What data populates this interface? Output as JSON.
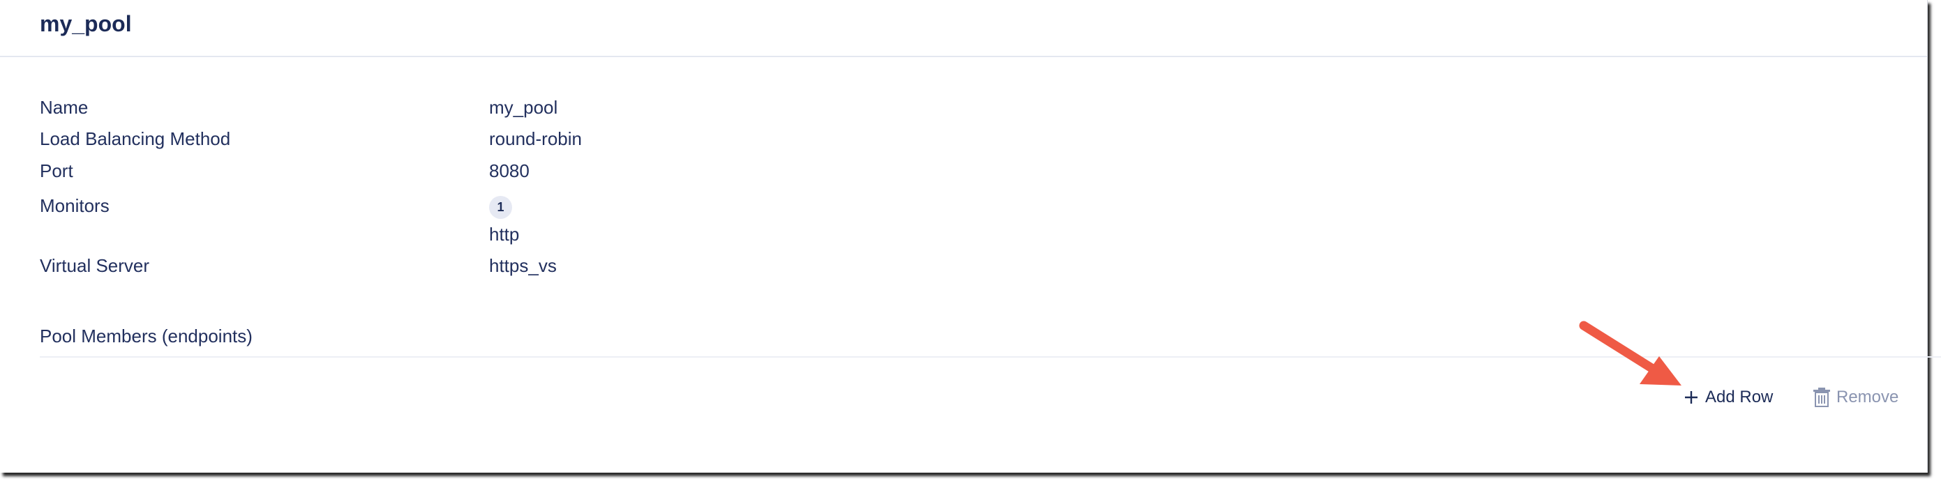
{
  "panel": {
    "title": "my_pool"
  },
  "properties": {
    "name": {
      "label": "Name",
      "value": "my_pool"
    },
    "load_balancing": {
      "label": "Load Balancing Method",
      "value": "round-robin"
    },
    "port": {
      "label": "Port",
      "value": "8080"
    },
    "monitors": {
      "label": "Monitors",
      "count": "1",
      "value": "http"
    },
    "virtual_server": {
      "label": "Virtual Server",
      "value": "https_vs"
    }
  },
  "pool_members": {
    "title": "Pool Members (endpoints)"
  },
  "actions": {
    "add_row": {
      "label": "Add Row",
      "icon": "plus-icon"
    },
    "remove": {
      "label": "Remove",
      "icon": "trash-icon"
    }
  },
  "colors": {
    "text_primary": "#22305e",
    "title": "#1c2b57",
    "disabled": "#8a94b0",
    "annotation_arrow": "#ef5a45",
    "badge_bg": "#e6e9f3"
  }
}
